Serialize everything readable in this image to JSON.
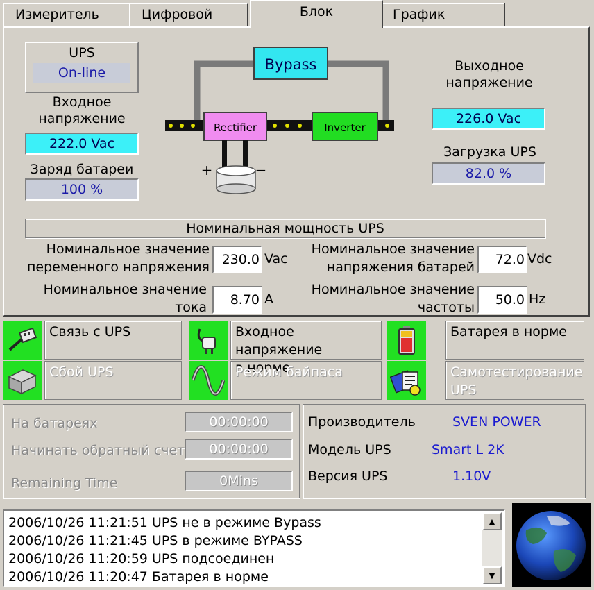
{
  "tabs": [
    {
      "label": "Измеритель",
      "active": false
    },
    {
      "label": "Цифровой",
      "active": false
    },
    {
      "label": "Блок",
      "active": true
    },
    {
      "label": "График",
      "active": false
    }
  ],
  "ups_box": {
    "title": "UPS",
    "mode": "On-line"
  },
  "input_voltage": {
    "label_line1": "Входное",
    "label_line2": "напряжение",
    "value": "222.0 Vac"
  },
  "battery_charge": {
    "label": "Заряд батареи",
    "value": "100 %"
  },
  "diagram": {
    "bypass": "Bypass",
    "rectifier": "Rectifier",
    "inverter": "Inverter",
    "plus": "+",
    "minus": "−",
    "colors": {
      "bypass": "#33e6f0",
      "rectifier": "#f08cf0",
      "inverter": "#22dd22",
      "line": "#7a7a7a"
    }
  },
  "output_voltage": {
    "label_line1": "Выходное",
    "label_line2": "напряжение",
    "value": "226.0 Vac"
  },
  "ups_load": {
    "label": "Загрузка UPS",
    "value": "82.0 %"
  },
  "nominal": {
    "header": "Номинальная мощность UPS",
    "ac_voltage": {
      "label_line1": "Номинальное значение",
      "label_line2": "переменного напряжения",
      "value": "230.0",
      "unit": "Vac"
    },
    "current": {
      "label_line1": "Номинальное значение",
      "label_line2": "тока",
      "value": "8.70",
      "unit": "A"
    },
    "battery_voltage": {
      "label_line1": "Номинальное значение",
      "label_line2": "напряжения батарей",
      "value": "72.0",
      "unit": "Vdc"
    },
    "frequency": {
      "label_line1": "Номинальное значение",
      "label_line2": "частоты",
      "value": "50.0",
      "unit": "Hz"
    }
  },
  "status": {
    "link": {
      "text": "Связь с UPS",
      "icon": "cable-plug-icon",
      "active": true
    },
    "input_ok": {
      "text_line1": "Входное напряжение",
      "text_line2": "в норме",
      "icon": "power-plug-icon",
      "active": true
    },
    "battery_ok": {
      "text": "Батарея в норме",
      "icon": "battery-icon",
      "active": true
    },
    "ups_fail": {
      "text": "Сбой UPS",
      "icon": "ups-box-icon",
      "active": false
    },
    "bypass_mode": {
      "text": "Режим байпаса",
      "icon": "sine-wave-icon",
      "active": false
    },
    "self_test": {
      "text_line1": "Самотестирование",
      "text_line2": "UPS",
      "icon": "self-test-icon",
      "active": false
    },
    "accent": "#22e022"
  },
  "timers": {
    "on_battery": {
      "label": "На батареях",
      "value": "00:00:00"
    },
    "countdown": {
      "label": "Начинать обратный счет",
      "value": "00:00:00"
    },
    "remaining": {
      "label": "Remaining Time",
      "value": "0Mins"
    }
  },
  "info": {
    "manufacturer": {
      "label": "Производитель",
      "value": "SVEN POWER"
    },
    "model": {
      "label": "Модель UPS",
      "value": "Smart L 2K"
    },
    "version": {
      "label": "Версия UPS",
      "value": "1.10V"
    }
  },
  "log": [
    "2006/10/26 11:21:51  UPS не в режиме Bypass",
    "2006/10/26 11:21:45  UPS в режиме BYPASS",
    "2006/10/26 11:20:59  UPS подсоединен",
    "2006/10/26 11:20:47  Батарея в норме"
  ],
  "globe_icon": "globe-icon"
}
